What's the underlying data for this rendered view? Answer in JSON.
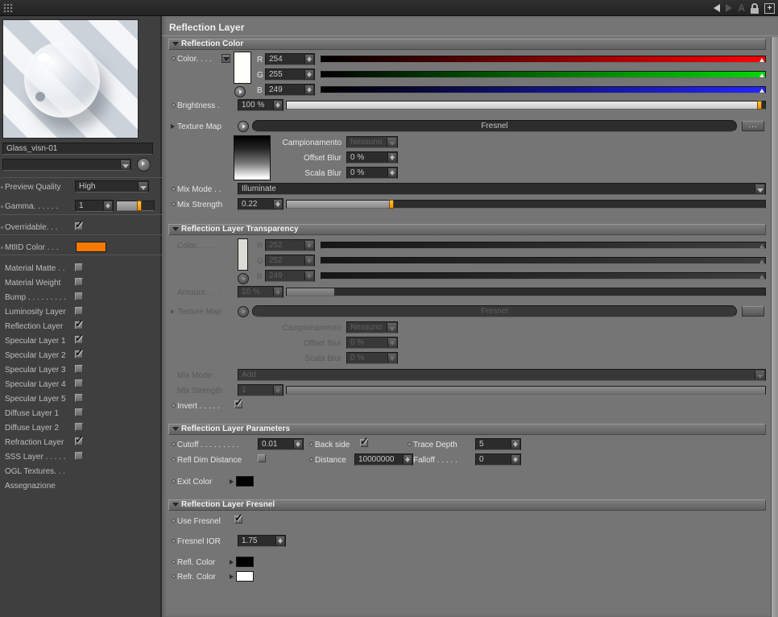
{
  "topbar": {
    "a_label": "A",
    "plus_label": "+"
  },
  "ui": {
    "more": "..."
  },
  "sidebar": {
    "material_name": "Glass_visn-01",
    "preview_quality": {
      "label": "Preview Quality",
      "value": "High"
    },
    "gamma": {
      "label": "Gamma. . . . . .",
      "value": "1",
      "percent": 62
    },
    "overridable": {
      "label": "Overridable. . .",
      "checked": true
    },
    "mtlid": {
      "label": "MtlID Color . . .",
      "color": "#f57900"
    },
    "layers": [
      {
        "label": "Material Matte  . .",
        "checked": false
      },
      {
        "label": "Material Weight",
        "checked": false
      },
      {
        "label": "Bump . . . . . . . . .",
        "checked": false
      },
      {
        "label": "Luminosity Layer",
        "checked": false
      },
      {
        "label": "Reflection Layer",
        "checked": true
      },
      {
        "label": "Specular Layer 1",
        "checked": true
      },
      {
        "label": "Specular Layer 2",
        "checked": true
      },
      {
        "label": "Specular Layer 3",
        "checked": false
      },
      {
        "label": "Specular Layer 4",
        "checked": false
      },
      {
        "label": "Specular Layer 5",
        "checked": false
      },
      {
        "label": "Diffuse Layer 1",
        "checked": false
      },
      {
        "label": "Diffuse Layer 2",
        "checked": false
      },
      {
        "label": "Refraction Layer",
        "checked": true
      },
      {
        "label": "SSS Layer . . . . .",
        "checked": false
      }
    ],
    "extra_items": [
      "OGL Textures. . .",
      "Assegnazione"
    ]
  },
  "main": {
    "title": "Reflection Layer",
    "reflection_color": {
      "header": "Reflection Color",
      "color_label": "Color. . . .",
      "swatch": "#fdfff9",
      "rgb": [
        {
          "channel": "R",
          "value": "254"
        },
        {
          "channel": "G",
          "value": "255"
        },
        {
          "channel": "B",
          "value": "249"
        }
      ],
      "brightness_label": "Brightness .",
      "brightness_value": "100 %",
      "brightness_percent": 99,
      "texture_label": "Texture Map",
      "texture_value": "Fresnel",
      "campionamento_label": "Campionamento",
      "campionamento_value": "Nessuno",
      "offset_blur_label": "Offset Blur",
      "offset_blur_value": "0 %",
      "scala_blur_label": "Scala Blur",
      "scala_blur_value": "0 %",
      "mix_mode_label": "Mix Mode . .",
      "mix_mode_value": "Illuminate",
      "mix_strength_label": "Mix Strength",
      "mix_strength_value": "0.22",
      "mix_strength_percent": 22
    },
    "transparency": {
      "header": "Reflection Layer Transparency",
      "color_label": "Color. . . . .",
      "swatch": "#dcdcd6",
      "rgb": [
        {
          "channel": "R",
          "value": "252"
        },
        {
          "channel": "G",
          "value": "252"
        },
        {
          "channel": "B",
          "value": "249"
        }
      ],
      "amount_label": "Amount. . . .",
      "amount_value": "10 %",
      "amount_percent": 10,
      "texture_label": "Texture Map",
      "texture_value": "Fresnel",
      "campionamento_label": "Campionamento",
      "campionamento_value": "Nessuno",
      "offset_blur_label": "Offset Blur",
      "offset_blur_value": "0 %",
      "scala_blur_label": "Scala Blur",
      "scala_blur_value": "0 %",
      "mix_mode_label": "Mix Mode . .",
      "mix_mode_value": "Add",
      "mix_strength_label": "Mix Strength",
      "mix_strength_value": "1",
      "mix_strength_percent": 100,
      "invert_label": "Invert . . . . .",
      "invert_checked": true
    },
    "parameters": {
      "header": "Reflection Layer Parameters",
      "cutoff_label": "Cutoff . . . . . . . . .",
      "cutoff_value": "0.01",
      "back_side_label": "Back side",
      "back_side_checked": true,
      "trace_depth_label": "Trace Depth",
      "trace_depth_value": "5",
      "refl_dim_label": "Refl Dim Distance",
      "refl_dim_checked": false,
      "distance_label": "Distance",
      "distance_value": "10000000",
      "falloff_label": "Falloff . . . . .",
      "falloff_value": "0",
      "exit_color_label": "Exit Color",
      "exit_color": "#000000"
    },
    "fresnel": {
      "header": "Reflection Layer Fresnel",
      "use_fresnel_label": "Use Fresnel",
      "use_fresnel_checked": true,
      "ior_label": "Fresnel IOR",
      "ior_value": "1.75",
      "refl_color_label": "Refl. Color",
      "refl_color": "#000000",
      "refr_color_label": "Refr. Color",
      "refr_color": "#ffffff"
    }
  }
}
